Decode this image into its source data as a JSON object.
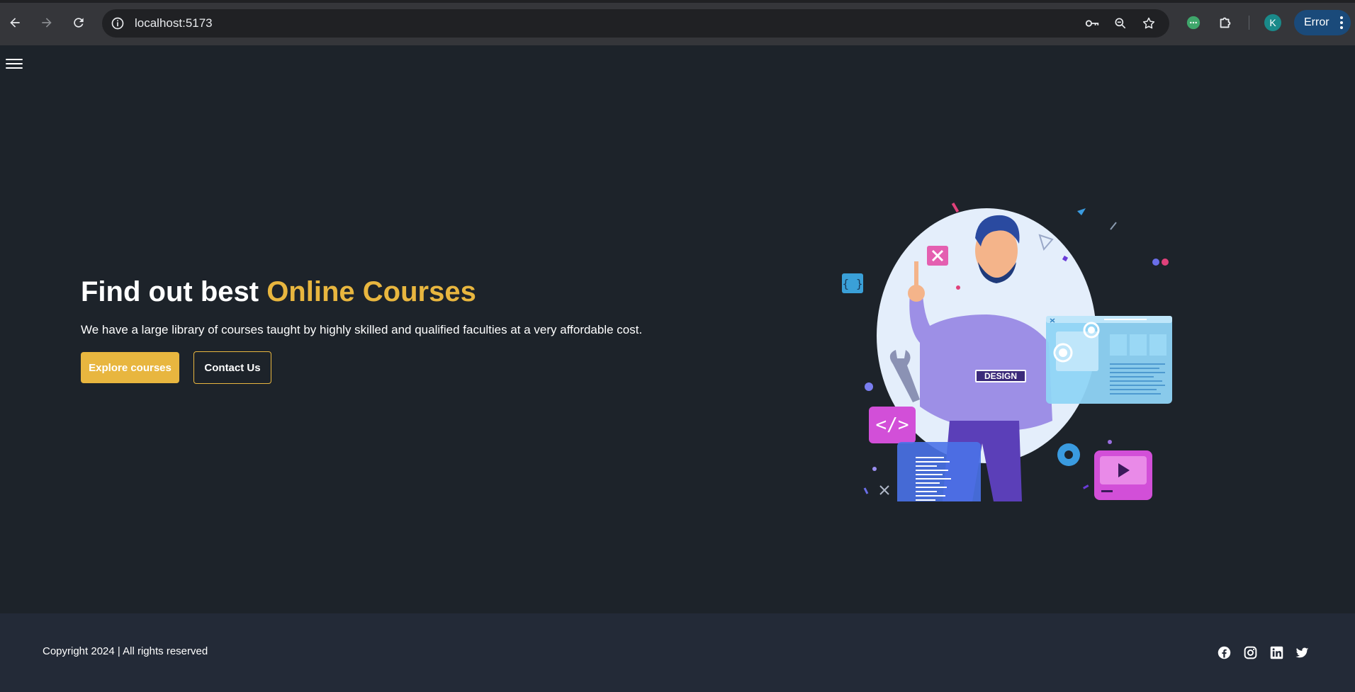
{
  "browser": {
    "url": "localhost:5173",
    "profile_initial": "K",
    "error_label": "Error"
  },
  "hero": {
    "title_plain": "Find out best ",
    "title_accent": "Online Courses",
    "subtitle": "We have a large library of courses taught by highly skilled and qualified faculties at a very affordable cost.",
    "primary_button": "Explore courses",
    "secondary_button": "Contact Us",
    "illustration_badge": "DESIGN"
  },
  "footer": {
    "copyright": "Copyright 2024 | All rights reserved",
    "social": [
      "facebook-icon",
      "instagram-icon",
      "linkedin-icon",
      "twitter-icon"
    ]
  },
  "colors": {
    "accent": "#e8b63f",
    "page_bg": "#1d232a",
    "footer_bg": "#232a37"
  }
}
